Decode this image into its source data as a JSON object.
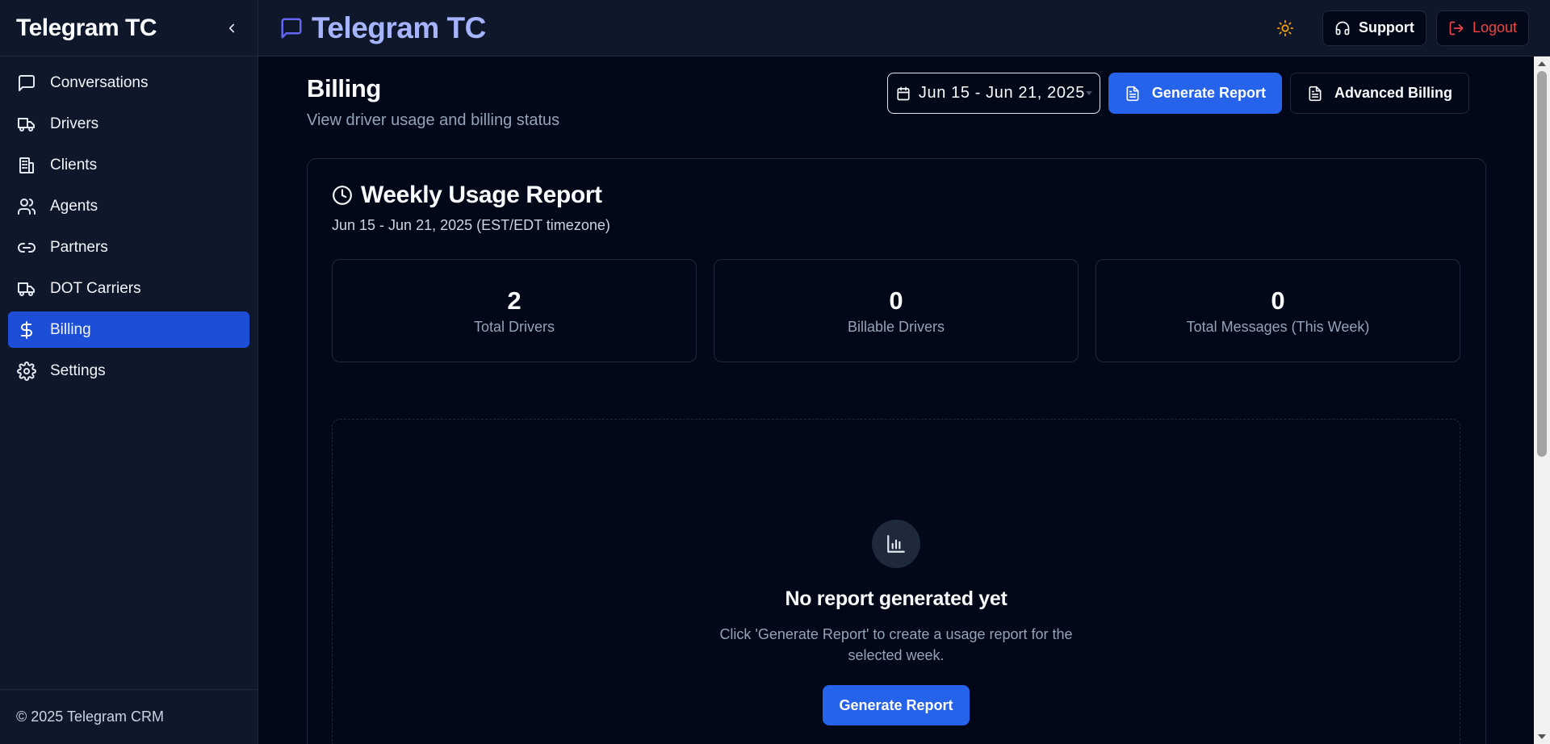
{
  "sidebar": {
    "title": "Telegram TC",
    "items": [
      {
        "label": "Conversations",
        "icon": "message-square-icon"
      },
      {
        "label": "Drivers",
        "icon": "truck-icon"
      },
      {
        "label": "Clients",
        "icon": "building-icon"
      },
      {
        "label": "Agents",
        "icon": "users-icon"
      },
      {
        "label": "Partners",
        "icon": "link-icon"
      },
      {
        "label": "DOT Carriers",
        "icon": "truck-icon"
      },
      {
        "label": "Billing",
        "icon": "dollar-sign-icon",
        "active": true
      },
      {
        "label": "Settings",
        "icon": "settings-icon"
      }
    ],
    "footer": "© 2025 Telegram CRM"
  },
  "topbar": {
    "brand_title": "Telegram TC",
    "support_label": "Support",
    "logout_label": "Logout"
  },
  "page": {
    "title": "Billing",
    "subtitle": "View driver usage and billing status",
    "date_range": "Jun 15 - Jun 21, 2025",
    "generate_report_label": "Generate Report",
    "advanced_billing_label": "Advanced Billing"
  },
  "report": {
    "title": "Weekly Usage Report",
    "subtitle": "Jun 15 - Jun 21, 2025 (EST/EDT timezone)",
    "stats": [
      {
        "value": "2",
        "label": "Total Drivers"
      },
      {
        "value": "0",
        "label": "Billable Drivers"
      },
      {
        "value": "0",
        "label": "Total Messages (This Week)"
      }
    ],
    "empty_title": "No report generated yet",
    "empty_desc": "Click 'Generate Report' to create a usage report for the selected week.",
    "empty_button": "Generate Report"
  },
  "colors": {
    "background": "#020817",
    "sidebar": "#0f172a",
    "accent": "#2563eb",
    "active_nav": "#1d4ed8",
    "brand": "#a5b4fc",
    "logout": "#ef4444",
    "sun": "#f59e0b"
  }
}
